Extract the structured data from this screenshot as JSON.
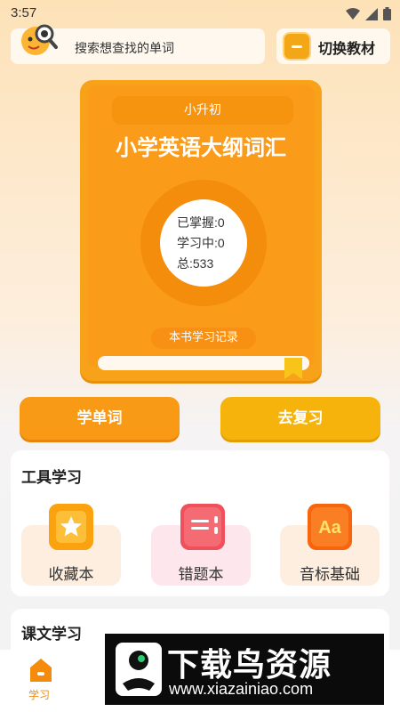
{
  "status_bar": {
    "time": "3:57"
  },
  "search": {
    "placeholder": "搜索想查找的单词"
  },
  "switch_textbook": {
    "label": "切换教材"
  },
  "book": {
    "level": "小升初",
    "title": "小学英语大纲词汇",
    "stats": {
      "mastered": "已掌握:0",
      "learning": "学习中:0",
      "total": "总:533"
    },
    "record_label": "本书学习记录"
  },
  "actions": {
    "learn": "学单词",
    "review": "去复习"
  },
  "tools": {
    "title": "工具学习",
    "items": [
      {
        "label": "收藏本",
        "icon": "star-icon"
      },
      {
        "label": "错题本",
        "icon": "notebook-icon"
      },
      {
        "label": "音标基础",
        "icon": "phonetics-aa-icon"
      }
    ]
  },
  "lessons": {
    "title": "课文学习"
  },
  "nav": {
    "home_label": "学习"
  },
  "watermark": {
    "title": "下载鸟资源",
    "url": "www.xiazainiao.com"
  }
}
